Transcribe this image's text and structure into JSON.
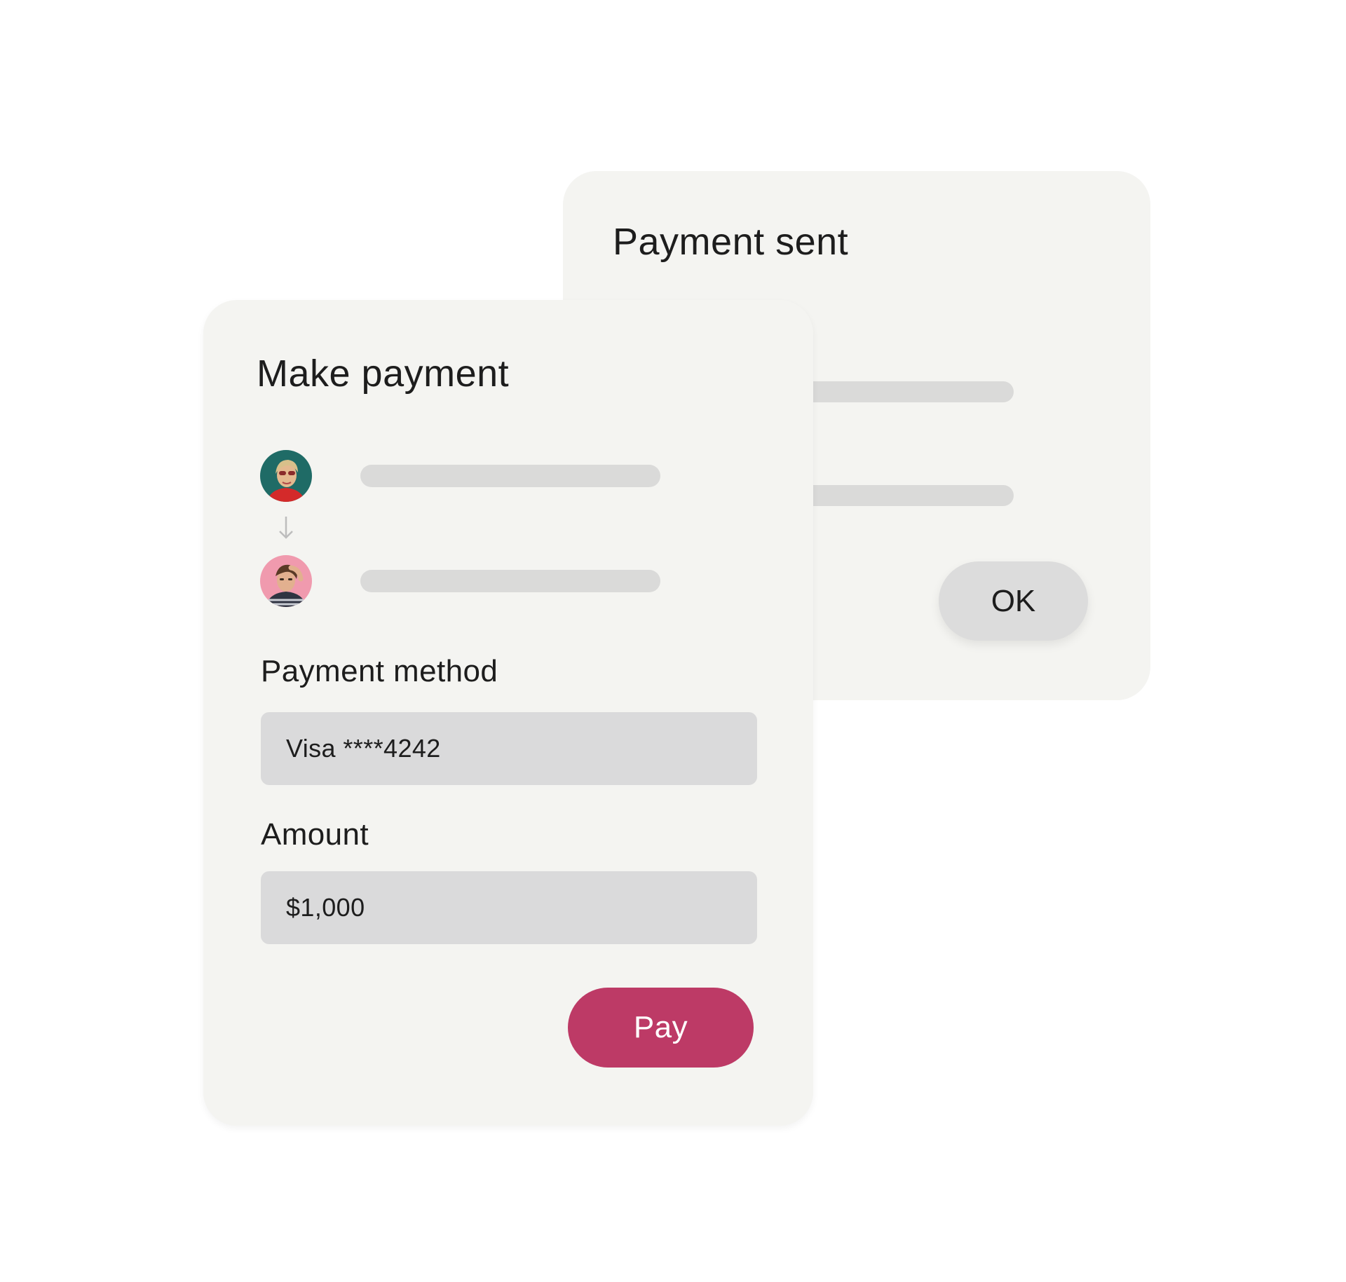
{
  "payment_sent_card": {
    "title": "Payment sent",
    "ok_label": "OK"
  },
  "make_payment_card": {
    "title": "Make payment",
    "sender_avatar_icon": "person-avatar",
    "recipient_avatar_icon": "person-avatar",
    "transfer_arrow_icon": "arrow-down-icon",
    "payment_method": {
      "label": "Payment method",
      "value": "Visa ****4242"
    },
    "amount": {
      "label": "Amount",
      "value": "$1,000"
    },
    "pay_label": "Pay"
  },
  "colors": {
    "card_background": "#f4f4f1",
    "skeleton": "#dadad9",
    "field_background": "#dadadb",
    "pay_button": "#bd3a66",
    "ok_button": "#dcdcdc"
  }
}
